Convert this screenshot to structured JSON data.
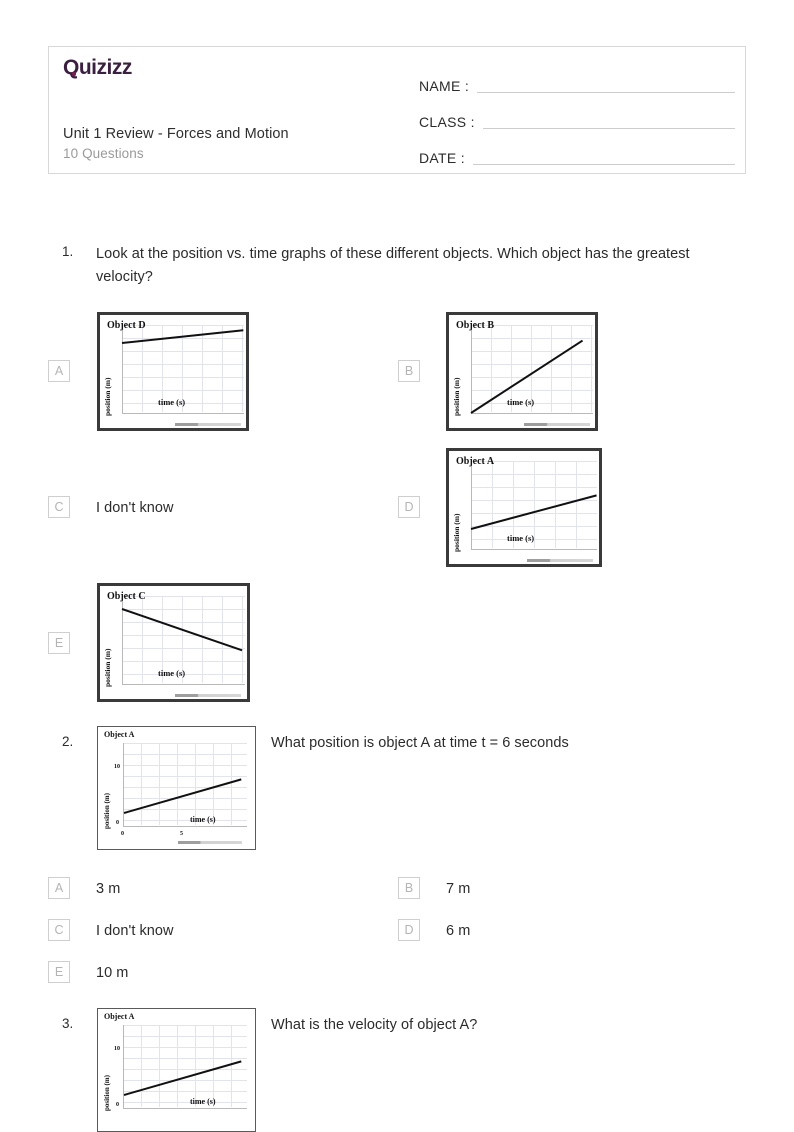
{
  "header": {
    "logo_text": "Quizizz",
    "logo_color": "#3b1f40",
    "quiz_title": "Unit 1 Review - Forces and Motion",
    "question_count": "10 Questions",
    "fields": [
      {
        "label": "NAME :"
      },
      {
        "label": "CLASS :"
      },
      {
        "label": "DATE  :"
      }
    ]
  },
  "questions": [
    {
      "number": "1.",
      "text": "Look at the position vs. time graphs of these different objects. Which object has the greatest velocity?",
      "options": [
        {
          "letter": "A",
          "text": "",
          "has_image": true,
          "image": "graph-object-d"
        },
        {
          "letter": "B",
          "text": "",
          "has_image": true,
          "image": "graph-object-b"
        },
        {
          "letter": "C",
          "text": "I don't know",
          "has_image": false
        },
        {
          "letter": "D",
          "text": "",
          "has_image": true,
          "image": "graph-object-a"
        },
        {
          "letter": "E",
          "text": "",
          "has_image": true,
          "image": "graph-object-c"
        }
      ]
    },
    {
      "number": "2.",
      "text": "What position is object A at time t = 6 seconds",
      "has_image": true,
      "options": [
        {
          "letter": "A",
          "text": "3 m"
        },
        {
          "letter": "B",
          "text": "7 m"
        },
        {
          "letter": "C",
          "text": "I don't know"
        },
        {
          "letter": "D",
          "text": "6 m"
        },
        {
          "letter": "E",
          "text": "10 m"
        }
      ]
    },
    {
      "number": "3.",
      "text": "What is the velocity of object A?",
      "has_image": true,
      "options": []
    }
  ],
  "graphs": {
    "object_d": {
      "title": "Object D",
      "ylabel": "position (m)",
      "xlabel": "time (s)"
    },
    "object_b": {
      "title": "Object B",
      "ylabel": "position (m)",
      "xlabel": "time (s)"
    },
    "object_a": {
      "title": "Object A",
      "ylabel": "position (m)",
      "xlabel": "time (s)"
    },
    "object_c": {
      "title": "Object C",
      "ylabel": "position (m)",
      "xlabel": "time (s)"
    },
    "object_a_q2": {
      "title": "Object A",
      "ylabel": "position (m)",
      "xlabel": "time (s)",
      "ytick_top": "10",
      "ytick_bottom": "0",
      "xtick_left": "0",
      "xtick_mid": "5"
    },
    "object_a_q3": {
      "title": "Object A",
      "ylabel": "position (m)",
      "xlabel": "time (s)",
      "ytick_top": "10",
      "ytick_bottom": "0"
    }
  }
}
